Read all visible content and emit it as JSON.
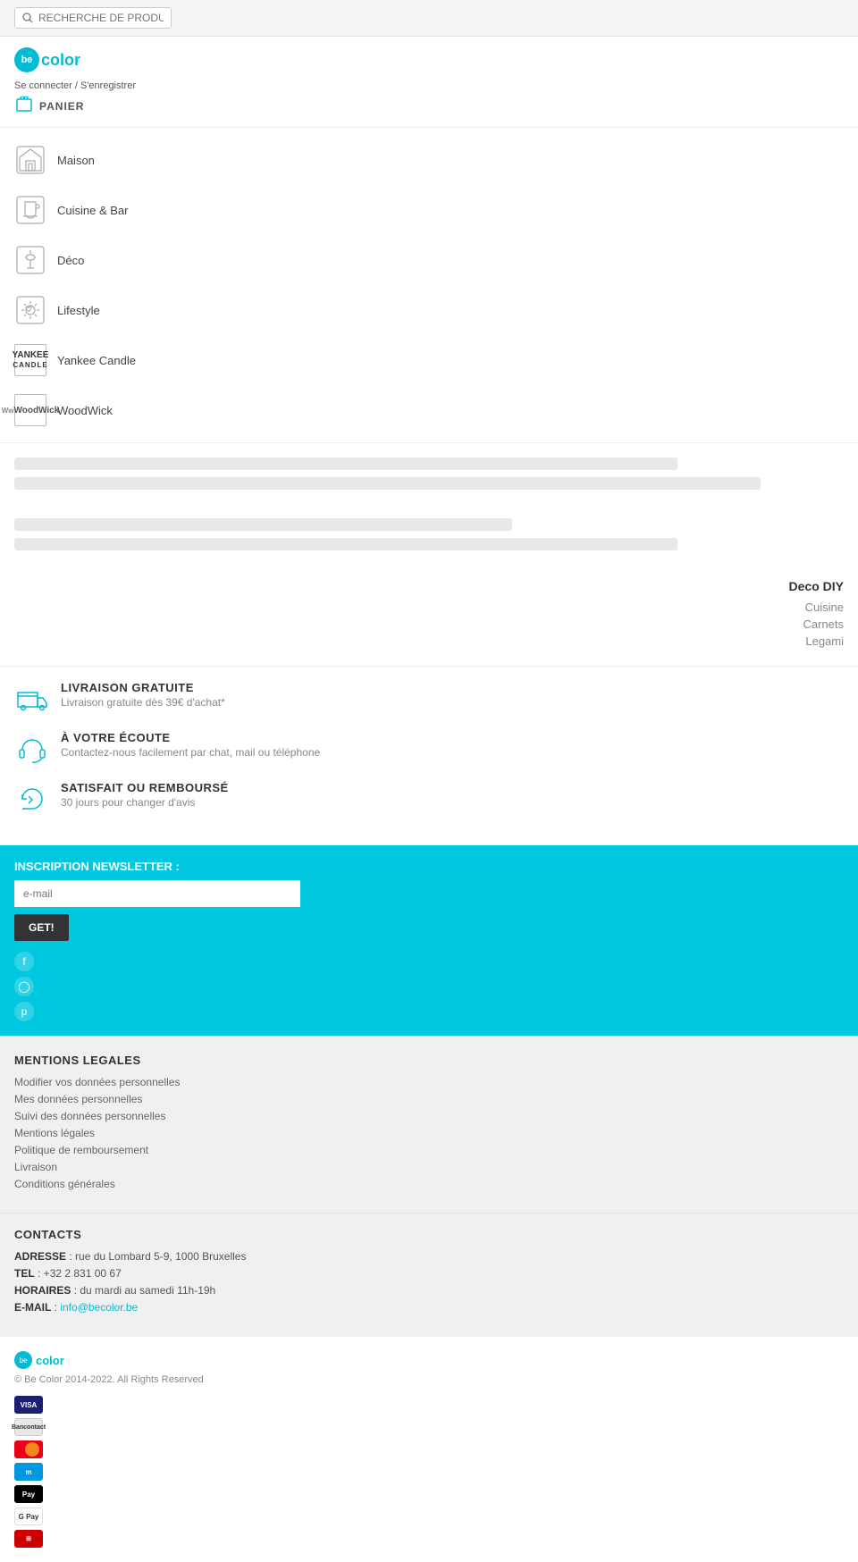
{
  "topbar": {
    "search_placeholder": "RECHERCHE DE PRODUITS"
  },
  "header": {
    "logo_text": "color",
    "login_label": "Se connecter / S'enregistrer",
    "cart_label": "PANIER"
  },
  "nav": {
    "items": [
      {
        "id": "maison",
        "label": "Maison",
        "icon": "home"
      },
      {
        "id": "cuisine-bar",
        "label": "Cuisine & Bar",
        "icon": "cup"
      },
      {
        "id": "deco",
        "label": "Déco",
        "icon": "lamp"
      },
      {
        "id": "lifestyle",
        "label": "Lifestyle",
        "icon": "sun"
      },
      {
        "id": "yankee-candle",
        "label": "Yankee Candle",
        "icon": "yankee"
      },
      {
        "id": "woodwick",
        "label": "WoodWick",
        "icon": "woodwick"
      }
    ]
  },
  "deco_diy": {
    "title": "Deco DIY",
    "links": [
      "Cuisine",
      "Carnets",
      "Legami"
    ]
  },
  "features": [
    {
      "id": "livraison",
      "title": "LIVRAISON GRATUITE",
      "desc": "Livraison gratuite dès 39€ d'achat*",
      "icon": "truck"
    },
    {
      "id": "ecoute",
      "title": "À VOTRE ÉCOUTE",
      "desc": "Contactez-nous facilement par chat, mail ou téléphone",
      "icon": "headphone"
    },
    {
      "id": "satisfait",
      "title": "SATISFAIT OU REMBOURSÉ",
      "desc": "30 jours pour changer d'avis",
      "icon": "return"
    }
  ],
  "newsletter": {
    "label": "INSCRIPTION NEWSLETTER :",
    "placeholder": "e-mail",
    "button_label": "GET!"
  },
  "social": {
    "icons": [
      "facebook",
      "instagram",
      "pinterest"
    ]
  },
  "footer_legal": {
    "title": "MENTIONS LEGALES",
    "links": [
      "Modifier vos données personnelles",
      "Mes données personnelles",
      "Suivi des données personnelles",
      "Mentions légales",
      "Politique de remboursement",
      "Livraison",
      "Conditions générales"
    ]
  },
  "footer_contacts": {
    "title": "CONTACTS",
    "address_label": "ADRESSE",
    "address_value": ": rue du Lombard 5-9, 1000 Bruxelles",
    "tel_label": "TEL",
    "tel_value": ": +32 2 831 00 67",
    "horaires_label": "HORAIRES",
    "horaires_value": ": du mardi au samedi 11h-19h",
    "email_label": "E-MAIL",
    "email_value": "info@becolor.be"
  },
  "bottom_footer": {
    "logo_text": "color",
    "copyright": "© Be Color 2014-2022. All Rights Reserved"
  },
  "payment_methods": [
    {
      "id": "visa",
      "label": "VISA"
    },
    {
      "id": "bancontact",
      "label": "BC"
    },
    {
      "id": "mastercard",
      "label": "MC"
    },
    {
      "id": "maestro",
      "label": "Maestro"
    },
    {
      "id": "applepay",
      "label": "⬛Pay"
    },
    {
      "id": "gpay",
      "label": "GPay"
    },
    {
      "id": "other",
      "label": "⊞"
    }
  ]
}
